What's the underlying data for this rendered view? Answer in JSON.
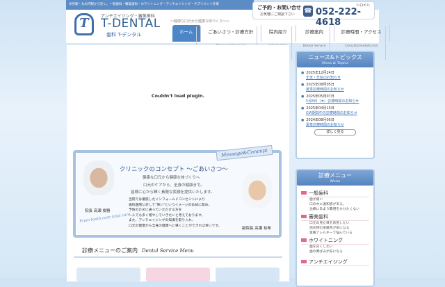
{
  "header": {
    "topbar": "伏見駅・丸の内駅から近く。一般歯科・審美歯科・ホワイトニング・アンチエイジング・サプリメント外来",
    "logo_sub": "アンチエイジング・審美歯科",
    "logo_main": "T-DENTAL",
    "logo_jp": "歯科 T-デンタル",
    "tagline": "〜健康な口元から健康な体づくりへ〜",
    "contact_label": "ご予約・お問い合せ",
    "contact_note": "お気軽にご相談下さい",
    "phone": "052-222-4618",
    "phone_kana": "シロイハ"
  },
  "nav": [
    {
      "label": "ホーム",
      "sub": "Home"
    },
    {
      "label": "ごあいさつ・診療方針",
      "sub": "Message&Concept"
    },
    {
      "label": "院内紹介",
      "sub": "Introduction"
    },
    {
      "label": "診療案内",
      "sub": "Dental Service"
    },
    {
      "label": "診療時間・アクセス",
      "sub": "Consultation&Access"
    }
  ],
  "plugin_message": "Couldn't load plugin.",
  "concept": {
    "badge": "Message&Concept",
    "title": "クリニックのコンセプト 〜ごあいさつ〜",
    "line1": "健康な口元から健康な体づくりへ",
    "line2": "口元のケアから、全身の健康まで。",
    "line3": "皆様に心から輝く素敵な笑顔を提供いたします。",
    "body": "当院では徹底したインフォームドコンセントにより\n歯科医院に対して\"怖い\"というイメージの払拭に努め、\n予防のために通っていただける方を\n一人でも多く増やしていきたいと考えております。\nまた、アンチエイジングの知識を取り入れ、\n口元の健康から全身の健康へと導くことができれば幸いです。",
    "director": "院長 高瀬 俊勝",
    "vice_director": "副院長 高瀬 有希",
    "script": "From tooth care total care"
  },
  "service_title": "診療メニューのご案内",
  "service_title_en": "Dental Service Menu",
  "news": {
    "title": "ニュース&トピックス",
    "title_en": "News & Topics",
    "items": [
      {
        "date": "2025年12月24日",
        "link": "年末・年始のお知らせ"
      },
      {
        "date": "2025年08月05日",
        "link": "夏季診療時間のお知らせ"
      },
      {
        "date": "2025年05月07日",
        "link": "5月8日（木）診療時間のお知らせ"
      },
      {
        "date": "2025年04月15日",
        "link": "GW期間中の診療時間のお知らせ"
      },
      {
        "date": "2024年08月05日",
        "link": "夏季診療時間のお知らせ"
      }
    ],
    "more": "詳しく見る"
  },
  "menu": {
    "title": "診療メニュー",
    "title_en": "Menu",
    "sections": [
      {
        "heading": "一般歯科",
        "items": [
          "歯が痛い",
          "口の中に違和感がある。",
          "治療にあまり費用をかけたくない"
        ]
      },
      {
        "heading": "審美歯科",
        "items": [
          "口元の見た目を改善したい",
          "詰め物の金属色が気になる",
          "金属アレルギーで悩んでいる"
        ]
      },
      {
        "heading": "ホワイトニング",
        "items": [
          "歯を白くしたい",
          "歯の黄ばみが気になる"
        ]
      },
      {
        "heading": "アンチエイジング",
        "items": []
      }
    ]
  }
}
